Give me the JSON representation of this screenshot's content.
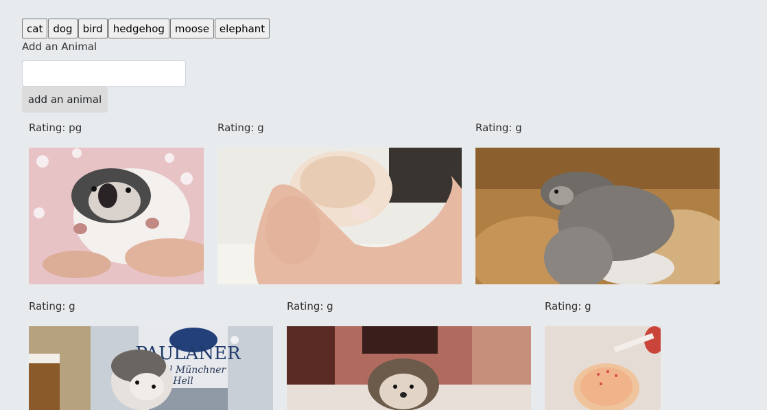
{
  "topics": [
    "cat",
    "dog",
    "bird",
    "hedgehog",
    "moose",
    "elephant"
  ],
  "form": {
    "label": "Add an Animal",
    "input_value": "",
    "button_label": "add an animal"
  },
  "gifs": [
    {
      "rating_text": "Rating: pg",
      "subject": "hedgehog-on-back-pink-blanket-icon"
    },
    {
      "rating_text": "Rating: g",
      "subject": "hedgehog-in-hands-icon"
    },
    {
      "rating_text": "Rating: g",
      "subject": "baby-hedgehogs-on-fur-icon"
    },
    {
      "rating_text": "Rating: g",
      "subject": "hedgehog-with-paulaner-beer-icon"
    },
    {
      "rating_text": "Rating: g",
      "subject": "hedgehog-in-bedroom-icon"
    },
    {
      "rating_text": "Rating: g",
      "subject": "hedgehog-bath-icon"
    }
  ],
  "beer_label": {
    "brand": "PAULANER",
    "line1": "riginal Münchner",
    "line2": "Hell"
  }
}
